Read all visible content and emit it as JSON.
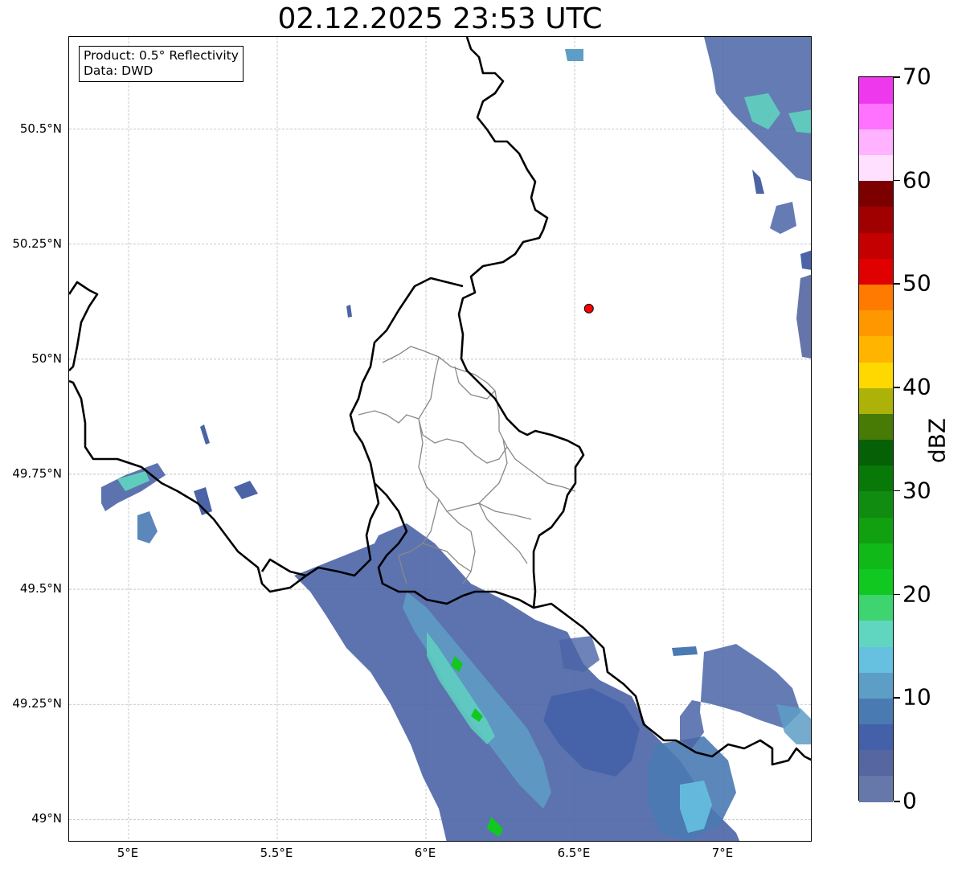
{
  "title": "02.12.2025 23:53 UTC",
  "info": {
    "product": "Product: 0.5° Reflectivity",
    "data": "Data: DWD"
  },
  "map": {
    "lon_range": [
      4.8,
      7.3
    ],
    "lat_range": [
      48.95,
      50.7
    ],
    "x_ticks": [
      {
        "value": 5.0,
        "label": "5°E"
      },
      {
        "value": 5.5,
        "label": "5.5°E"
      },
      {
        "value": 6.0,
        "label": "6°E"
      },
      {
        "value": 6.5,
        "label": "6.5°E"
      },
      {
        "value": 7.0,
        "label": "7°E"
      }
    ],
    "y_ticks": [
      {
        "value": 49.0,
        "label": "49°N"
      },
      {
        "value": 49.25,
        "label": "49.25°N"
      },
      {
        "value": 49.5,
        "label": "49.5°N"
      },
      {
        "value": 49.75,
        "label": "49.75°N"
      },
      {
        "value": 50.0,
        "label": "50°N"
      },
      {
        "value": 50.25,
        "label": "50.25°N"
      },
      {
        "value": 50.5,
        "label": "50.5°N"
      }
    ],
    "grid": true,
    "marker": {
      "lon": 6.548,
      "lat": 50.11,
      "color": "#ff0000"
    }
  },
  "colorbar": {
    "label": "dBZ",
    "min": 0,
    "max": 70,
    "ticks": [
      {
        "value": 0,
        "label": "0"
      },
      {
        "value": 10,
        "label": "10"
      },
      {
        "value": 20,
        "label": "20"
      },
      {
        "value": 30,
        "label": "30"
      },
      {
        "value": 40,
        "label": "40"
      },
      {
        "value": 50,
        "label": "50"
      },
      {
        "value": 60,
        "label": "60"
      },
      {
        "value": 70,
        "label": "70"
      }
    ],
    "colors": [
      "#6677aa",
      "#5566a0",
      "#4460a8",
      "#4a7ab2",
      "#5d9ec6",
      "#66c0e0",
      "#60d6c0",
      "#3ed470",
      "#10c820",
      "#10b818",
      "#10a010",
      "#108c10",
      "#087808",
      "#066006",
      "#487a06",
      "#acb208",
      "#ffd800",
      "#ffb400",
      "#ff9800",
      "#ff7a00",
      "#e00000",
      "#c40000",
      "#a00000",
      "#7c0000",
      "#ffe0ff",
      "#ffb2ff",
      "#ff72ff",
      "#ee38ee"
    ]
  }
}
